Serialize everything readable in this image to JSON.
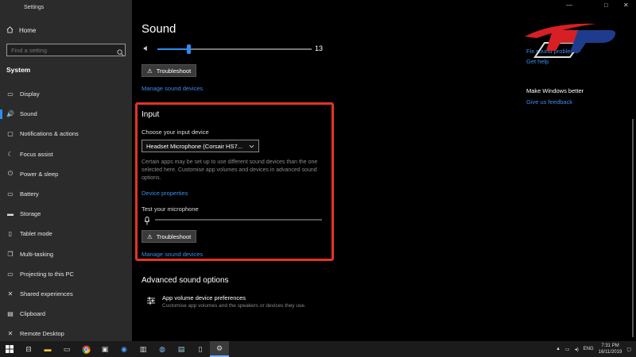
{
  "window": {
    "title": "Settings",
    "controls": [
      "—",
      "□",
      "✕"
    ]
  },
  "sidebar": {
    "home_label": "Home",
    "search_placeholder": "Find a setting",
    "section_title": "System",
    "items": [
      {
        "label": "Display",
        "icon": "display-icon",
        "glyph": "▭"
      },
      {
        "label": "Sound",
        "icon": "speaker-icon",
        "glyph": "🔊"
      },
      {
        "label": "Notifications & actions",
        "icon": "notification-icon",
        "glyph": "▢"
      },
      {
        "label": "Focus assist",
        "icon": "moon-icon",
        "glyph": "☾"
      },
      {
        "label": "Power & sleep",
        "icon": "power-icon",
        "glyph": "⏻"
      },
      {
        "label": "Battery",
        "icon": "battery-icon",
        "glyph": "▭"
      },
      {
        "label": "Storage",
        "icon": "storage-icon",
        "glyph": "▬"
      },
      {
        "label": "Tablet mode",
        "icon": "tablet-icon",
        "glyph": "▯"
      },
      {
        "label": "Multi-tasking",
        "icon": "multitask-icon",
        "glyph": "❐"
      },
      {
        "label": "Projecting to this PC",
        "icon": "projector-icon",
        "glyph": "▭"
      },
      {
        "label": "Shared experiences",
        "icon": "shared-icon",
        "glyph": "✕"
      },
      {
        "label": "Clipboard",
        "icon": "clipboard-icon",
        "glyph": "▤"
      },
      {
        "label": "Remote Desktop",
        "icon": "remote-icon",
        "glyph": "✕"
      }
    ]
  },
  "output": {
    "heading": "Sound",
    "volume_value": "13",
    "volume_fraction": 0.2,
    "troubleshoot_label": "Troubleshoot",
    "manage_label": "Manage sound devices"
  },
  "input": {
    "heading": "Input",
    "choose_label": "Choose your input device",
    "device_value": "Headset Microphone (Corsair HS7...",
    "description": "Certain apps may be set up to use different sound devices than the one selected here. Customise app volumes and devices in advanced sound options.",
    "device_properties_label": "Device properties",
    "test_label": "Test your microphone",
    "troubleshoot_label": "Troubleshoot",
    "manage_label": "Manage sound devices"
  },
  "advanced": {
    "heading": "Advanced sound options",
    "app_volume_title": "App volume  device preferences",
    "app_volume_desc": "Customise app volumes and the speakers or devices they use."
  },
  "right": {
    "fix_link": "Fix sound problems",
    "help_link": "Get help",
    "better_title": "Make Windows better",
    "feedback_link": "Give us feedback"
  },
  "taskbar": {
    "tray_lang": "ENG",
    "time": "7:31 PM",
    "date": "16/11/2019"
  },
  "colors": {
    "accent": "#2d8cf0",
    "highlight_box": "#e53325",
    "link": "#3b8ee8"
  }
}
